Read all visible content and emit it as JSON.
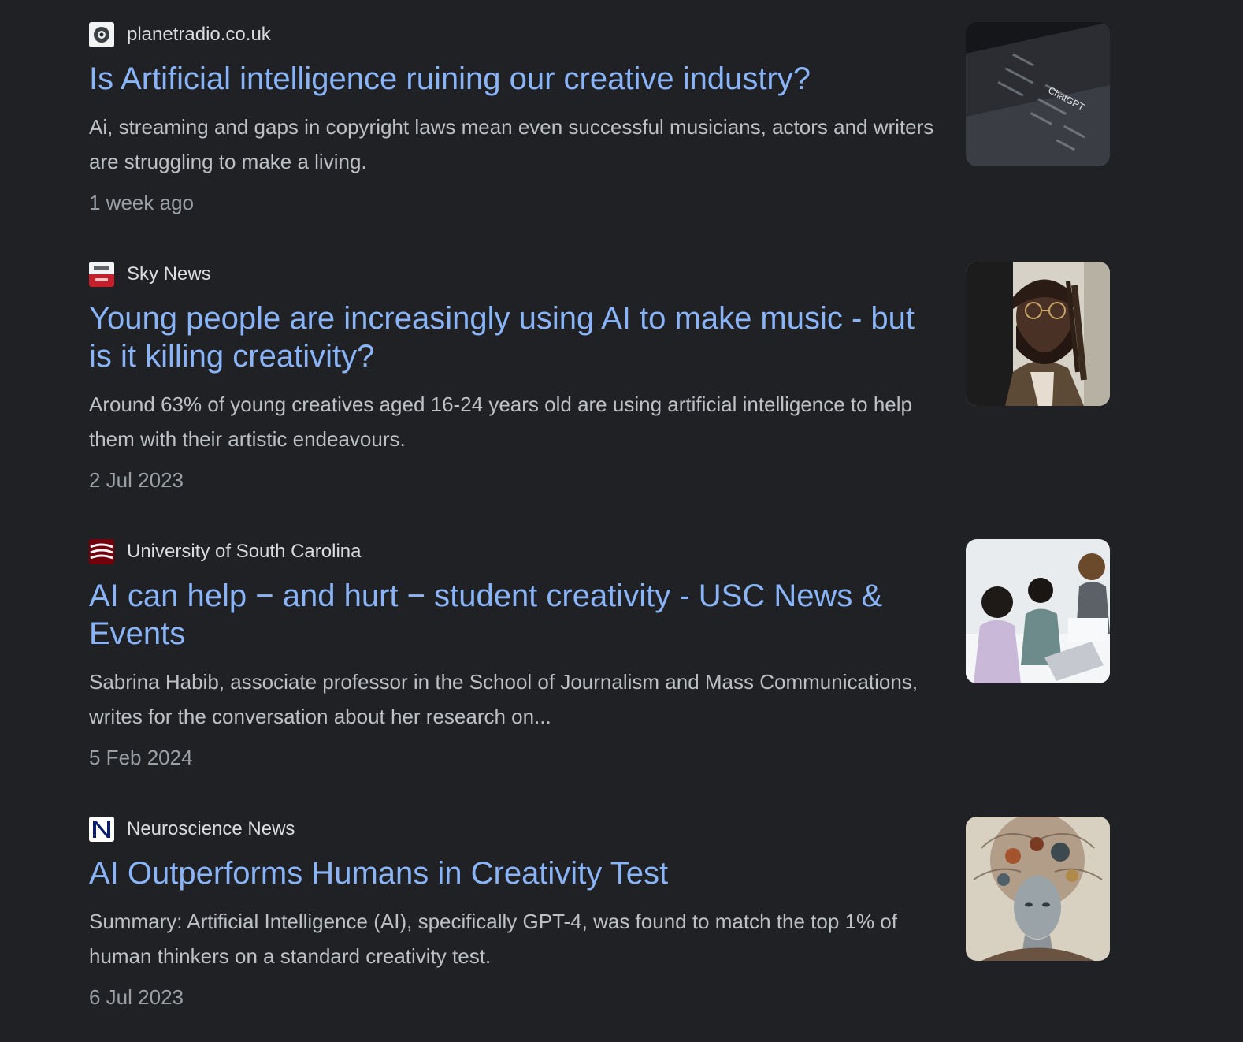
{
  "results": [
    {
      "source": "planetradio.co.uk",
      "favicon": "planetradio-logo-icon",
      "title": "Is Artificial intelligence ruining our creative industry?",
      "snippet": "Ai, streaming and gaps in copyright laws mean even successful musicians, actors and writers are struggling to make a living.",
      "date": "1 week ago",
      "thumbnail": "chatgpt-screen-image"
    },
    {
      "source": "Sky News",
      "favicon": "sky-news-logo-icon",
      "title": "Young people are increasingly using AI to make music - but is it killing creativity?",
      "snippet": "Around 63% of young creatives aged 16-24 years old are using artificial intelligence to help them with their artistic endeavours.",
      "date": "2 Jul 2023",
      "thumbnail": "man-portrait-image"
    },
    {
      "source": "University of South Carolina",
      "favicon": "usc-logo-icon",
      "title": "AI can help − and hurt − student creativity - USC News & Events",
      "snippet": "Sabrina Habib, associate professor in the School of Journalism and Mass Communications, writes for the conversation about her research on...",
      "date": "5 Feb 2024",
      "thumbnail": "students-laptop-image"
    },
    {
      "source": "Neuroscience News",
      "favicon": "neuroscience-news-logo-icon",
      "title": "AI Outperforms Humans in Creativity Test",
      "snippet": "Summary: Artificial Intelligence (AI), specifically GPT-4, was found to match the top 1% of human thinkers on a standard creativity test.",
      "date": "6 Jul 2023",
      "thumbnail": "ai-head-artwork-image"
    }
  ],
  "thumbnail_texts": {
    "chatgpt": "ChatGPT"
  },
  "colors": {
    "background": "#202124",
    "title_link": "#8ab4f8",
    "snippet": "#bdc1c6",
    "date": "#9aa0a6",
    "source": "#dadce0"
  }
}
